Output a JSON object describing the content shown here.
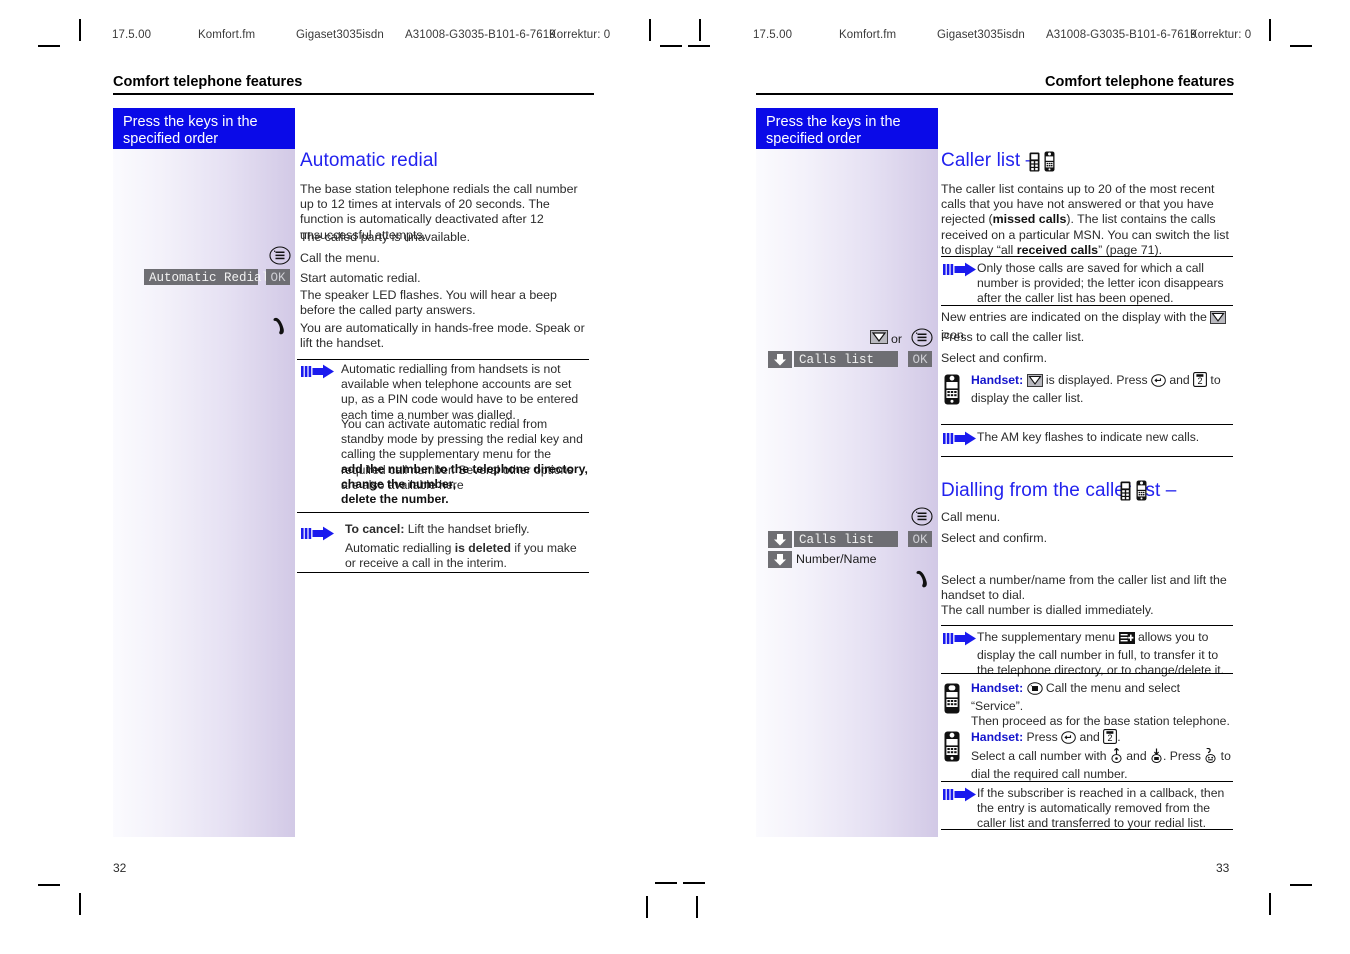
{
  "doc": {
    "runhead_left": {
      "date": "17.5.00",
      "file": "Komfort.fm",
      "product": "Gigaset3035isdn",
      "partnum": "A31008-G3035-B101-6-7619",
      "correction": "Korrektur: 0"
    },
    "runhead_right": {
      "date": "17.5.00",
      "file": "Komfort.fm",
      "product": "Gigaset3035isdn",
      "partnum": "A31008-G3035-B101-6-7619",
      "correction": "Korrektur: 0"
    }
  },
  "left_page": {
    "chapter_title": "Comfort telephone features",
    "page_number": "32",
    "banner": "Press the keys in the\nspecified order",
    "section_title": "Automatic redial",
    "paras": {
      "p1": "The base station telephone redials the call number up to 12 times at intervals of 20 seconds. The function is automatically deactivated after 12 unsuccessful attempts.",
      "p2": "The called party is unavailable.",
      "p3": "Call the menu.",
      "p4": "Start automatic redial.",
      "p5": "The speaker LED flashes. You will hear a beep before the called party answers.",
      "p6": "You are automatically in hands-free mode. Speak or lift the handset."
    },
    "widgets": {
      "menu_key": "menu-key-icon",
      "field_label": "Automatic Redial",
      "ok_label": "OK",
      "handset_lift": "handset-lift-icon"
    },
    "note1": {
      "line1": "Automatic redialling from handsets is not available when telephone accounts are set up, as a PIN code would have to be entered each time a number was dialled.",
      "line2": "You can activate automatic redial from standby mode by pressing the redial key and calling the supplementary menu for the required call number. Several other options are also available here",
      "bullets": [
        "add the number to the telephone directory,",
        "change the number,",
        "delete the number."
      ]
    },
    "note2": {
      "lead_bold": "To cancel:",
      "lead_rest": " Lift the handset briefly.",
      "body_pre": "Automatic redialling ",
      "body_bold": "is deleted",
      "body_post": " if you make or receive a call in the interim."
    }
  },
  "right_page": {
    "chapter_title": "Comfort telephone features",
    "page_number": "33",
    "banner": "Press the keys in the\nspecified order",
    "section_title": "Caller list –",
    "section_title2": "Dialling from the caller list –",
    "paras": {
      "intro_a": "The caller list contains up to 20 of the most recent calls that you have not answered or that you have rejected (",
      "intro_b": "missed calls",
      "intro_c": "). The list contains the calls received on a particular MSN. You can switch the list to display “all ",
      "intro_d": "received calls",
      "intro_e": "” (page 71).",
      "new_entries_pre": "New entries are indicated on the display with the ",
      "new_entries_post": " icon.",
      "press_to_call": "Press to call the caller list.",
      "select_confirm": "Select and confirm.",
      "call_menu": "Call menu.",
      "select_confirm2": "Select and confirm.",
      "dial_text": "Select a number/name from the caller list and lift the handset to dial.\nThe call number is dialled immediately."
    },
    "widgets": {
      "or_label": "or",
      "envelope_icon": "envelope-display-icon",
      "menu_key": "menu-key-icon",
      "field_label": "Calls list",
      "ok_label": "OK",
      "field_label2": "Calls list",
      "ok_label2": "OK",
      "plain_label": "Number/Name",
      "handset_lift": "handset-lift-icon"
    },
    "note1": "Only those calls are saved for which a call number is provided; the letter icon disappears after the caller list has been opened.",
    "note2": "The AM key flashes to indicate new calls.",
    "note3_pre": "The supplementary menu ",
    "note3_post": " allows you to display the call number in full, to transfer it to the telephone directory, or to change/delete it.",
    "note4": "If the subscriber is reached in a callback, then the entry is automatically removed from the caller list and transferred to your redial list.",
    "handset1": {
      "label": "Handset:",
      "pre": " ",
      "mid": " is displayed. Press ",
      "mid2": " and ",
      "post": " to display the caller list.",
      "key2": "2"
    },
    "handset2": {
      "label": "Handset:",
      "text_a": " Call the menu and select “Service”.",
      "text_b": "Then proceed as for the base station telephone."
    },
    "handset3": {
      "label": "Handset:",
      "text_a": " Press ",
      "text_b": " and ",
      "key2": "2",
      "text_c": ".",
      "text_d": "Select a call number with ",
      "text_e": " and ",
      "text_f": ". Press ",
      "text_g": " to dial the required call number."
    }
  },
  "colors": {
    "banner_blue": "#0a0ae8",
    "heading_blue": "#2222ee",
    "arrow_blue": "#1a1aee",
    "field_grey": "#6e6e73",
    "body_grey": "#2b2b2b"
  }
}
